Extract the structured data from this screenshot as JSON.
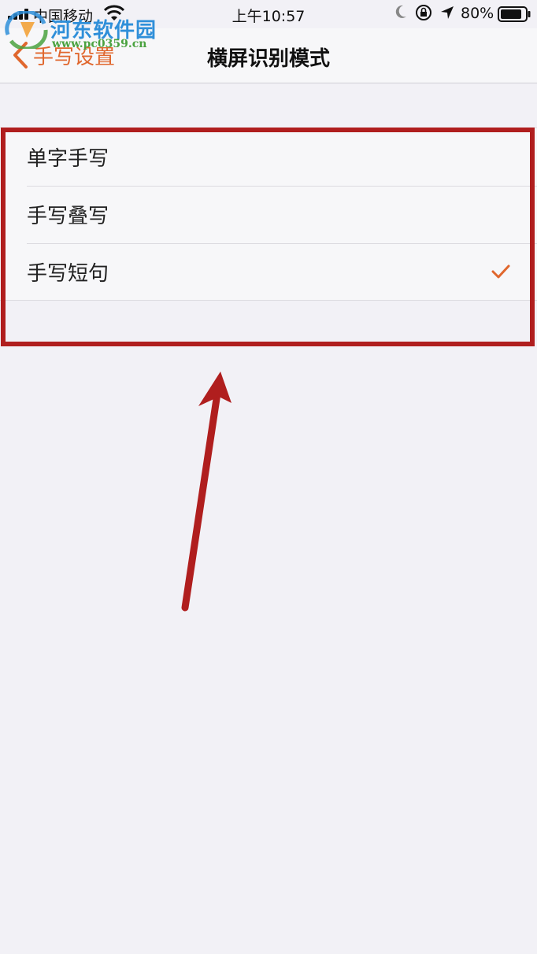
{
  "status_bar": {
    "carrier": "中国移动",
    "time": "上午10:57",
    "battery": "80%"
  },
  "watermark": {
    "name": "河东软件园",
    "url": "www.pc0359.cn"
  },
  "nav": {
    "back_label": "手写设置",
    "title": "横屏识别模式"
  },
  "options": [
    {
      "label": "单字手写",
      "selected": false
    },
    {
      "label": "手写叠写",
      "selected": false
    },
    {
      "label": "手写短句",
      "selected": true
    }
  ],
  "colors": {
    "accent": "#e0672e",
    "annotation": "#b01e1e"
  }
}
